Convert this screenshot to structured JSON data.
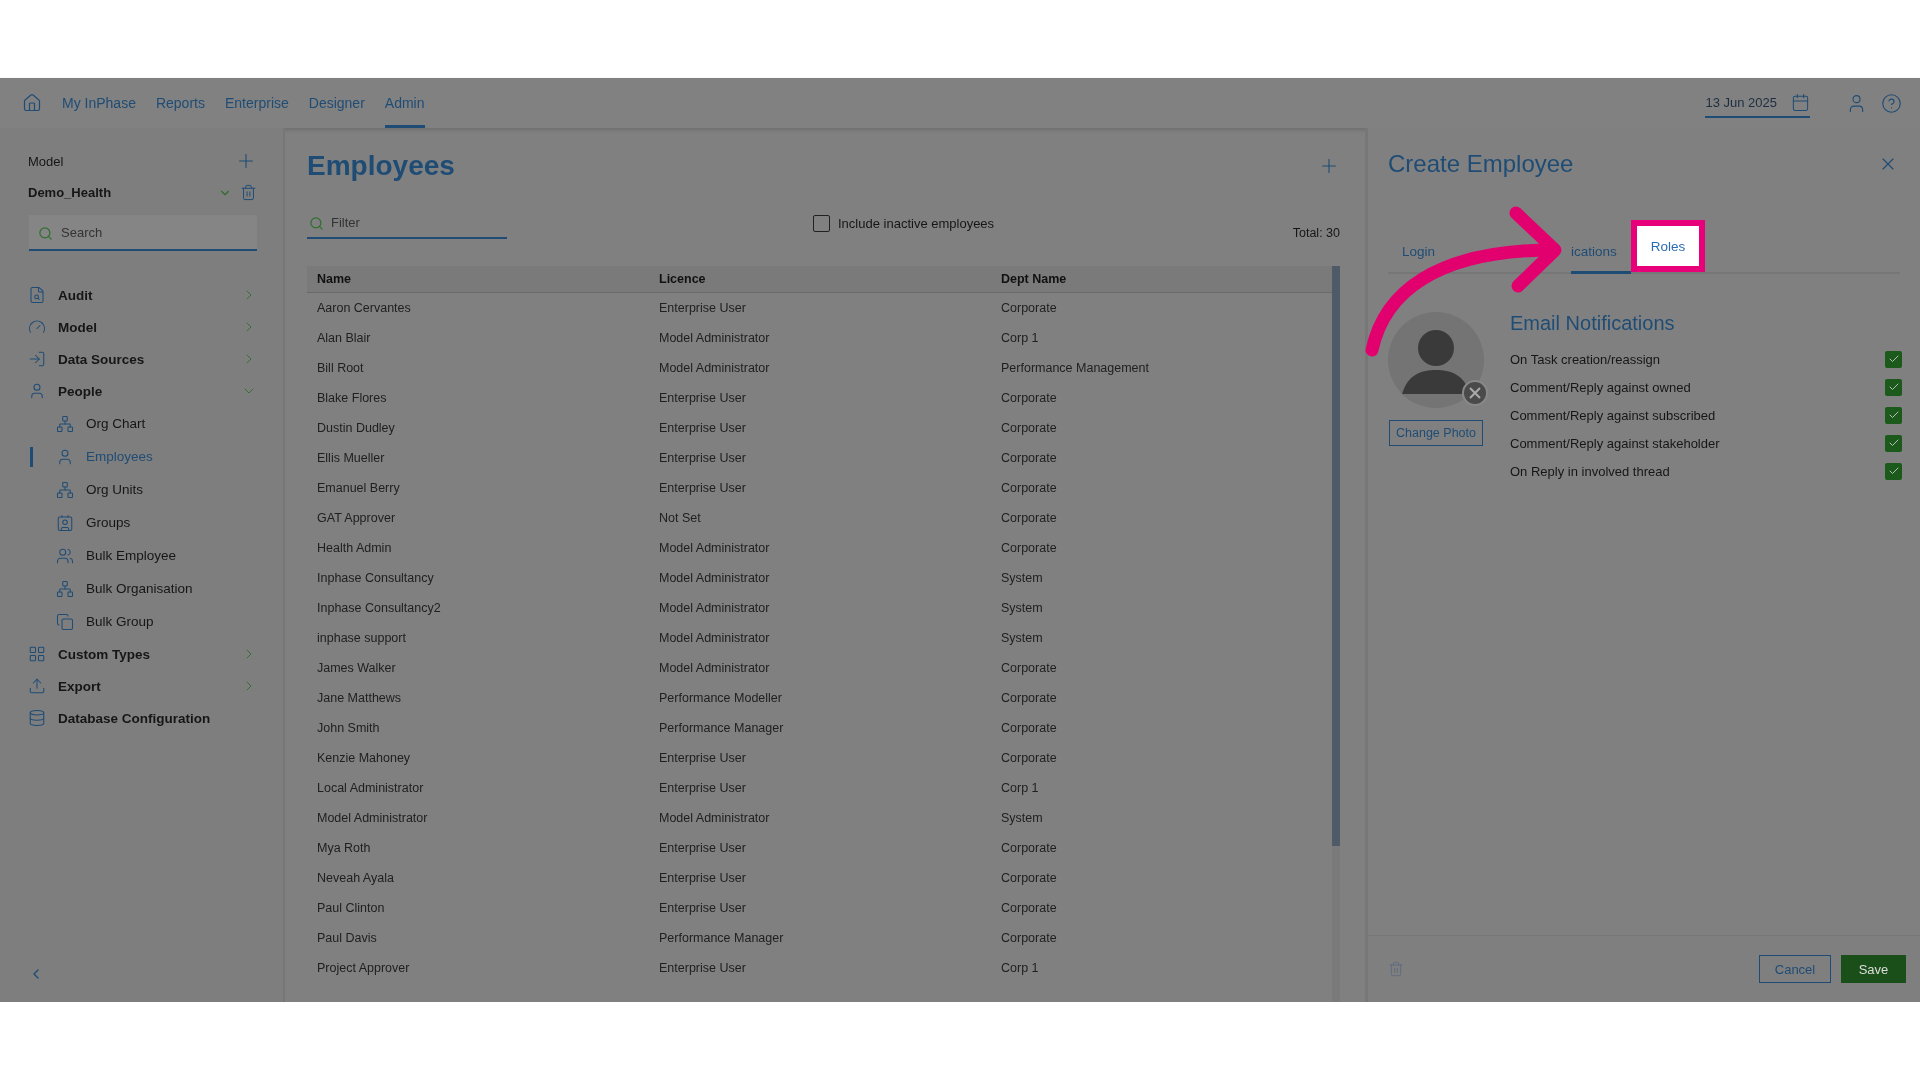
{
  "nav": {
    "items": [
      {
        "label": "My InPhase",
        "selected": false
      },
      {
        "label": "Reports",
        "selected": false
      },
      {
        "label": "Enterprise",
        "selected": false
      },
      {
        "label": "Designer",
        "selected": false
      },
      {
        "label": "Admin",
        "selected": true
      }
    ],
    "date": "13 Jun 2025"
  },
  "sidebar": {
    "model_label": "Model",
    "model_name": "Demo_Health",
    "search_placeholder": "Search",
    "items": [
      {
        "label": "Audit",
        "expanded": false
      },
      {
        "label": "Model",
        "expanded": false
      },
      {
        "label": "Data Sources",
        "expanded": false
      },
      {
        "label": "People",
        "expanded": true,
        "children": [
          {
            "label": "Org Chart",
            "selected": false
          },
          {
            "label": "Employees",
            "selected": true
          },
          {
            "label": "Org Units",
            "selected": false
          },
          {
            "label": "Groups",
            "selected": false
          },
          {
            "label": "Bulk Employee",
            "selected": false
          },
          {
            "label": "Bulk Organisation",
            "selected": false
          },
          {
            "label": "Bulk Group",
            "selected": false
          }
        ]
      },
      {
        "label": "Custom Types",
        "expanded": false
      },
      {
        "label": "Export",
        "expanded": false
      },
      {
        "label": "Database Configuration"
      }
    ]
  },
  "main": {
    "title": "Employees",
    "filter_placeholder": "Filter",
    "include_inactive": {
      "label": "Include inactive employees",
      "checked": false
    },
    "total": "Total: 30",
    "table": {
      "columns": [
        "Name",
        "Licence",
        "Dept Name"
      ],
      "rows": [
        [
          "Aaron Cervantes",
          "Enterprise User",
          "Corporate"
        ],
        [
          "Alan Blair",
          "Model Administrator",
          "Corp 1"
        ],
        [
          "Bill Root",
          "Model Administrator",
          "Performance Management"
        ],
        [
          "Blake Flores",
          "Enterprise User",
          "Corporate"
        ],
        [
          "Dustin Dudley",
          "Enterprise User",
          "Corporate"
        ],
        [
          "Ellis Mueller",
          "Enterprise User",
          "Corporate"
        ],
        [
          "Emanuel Berry",
          "Enterprise User",
          "Corporate"
        ],
        [
          "GAT Approver",
          "Not Set",
          "Corporate"
        ],
        [
          "Health Admin",
          "Model Administrator",
          "Corporate"
        ],
        [
          "Inphase Consultancy",
          "Model Administrator",
          "System"
        ],
        [
          "Inphase Consultancy2",
          "Model Administrator",
          "System"
        ],
        [
          "inphase support",
          "Model Administrator",
          "System"
        ],
        [
          "James Walker",
          "Model Administrator",
          "Corporate"
        ],
        [
          "Jane Matthews",
          "Performance Modeller",
          "Corporate"
        ],
        [
          "John Smith",
          "Performance Manager",
          "Corporate"
        ],
        [
          "Kenzie Mahoney",
          "Enterprise User",
          "Corporate"
        ],
        [
          "Local Administrator",
          "Enterprise User",
          "Corp 1"
        ],
        [
          "Model Administrator",
          "Model Administrator",
          "System"
        ],
        [
          "Mya Roth",
          "Enterprise User",
          "Corporate"
        ],
        [
          "Neveah Ayala",
          "Enterprise User",
          "Corporate"
        ],
        [
          "Paul Clinton",
          "Enterprise User",
          "Corporate"
        ],
        [
          "Paul Davis",
          "Performance Manager",
          "Corporate"
        ],
        [
          "Project Approver",
          "Enterprise User",
          "Corp 1"
        ]
      ]
    }
  },
  "panel": {
    "title": "Create Employee",
    "tabs": [
      {
        "label": "Login",
        "selected": false,
        "highlighted": false
      },
      {
        "label": "ications",
        "selected": true,
        "highlighted": false
      },
      {
        "label": "Roles",
        "selected": false,
        "highlighted": true
      }
    ],
    "change_photo": "Change Photo",
    "section_title": "Email Notifications",
    "notifications": [
      {
        "label": "On Task creation/reassign",
        "checked": true
      },
      {
        "label": "Comment/Reply against owned",
        "checked": true
      },
      {
        "label": "Comment/Reply against subscribed",
        "checked": true
      },
      {
        "label": "Comment/Reply against stakeholder",
        "checked": true
      },
      {
        "label": "On Reply in involved thread",
        "checked": true
      }
    ],
    "cancel": "Cancel",
    "save": "Save"
  }
}
